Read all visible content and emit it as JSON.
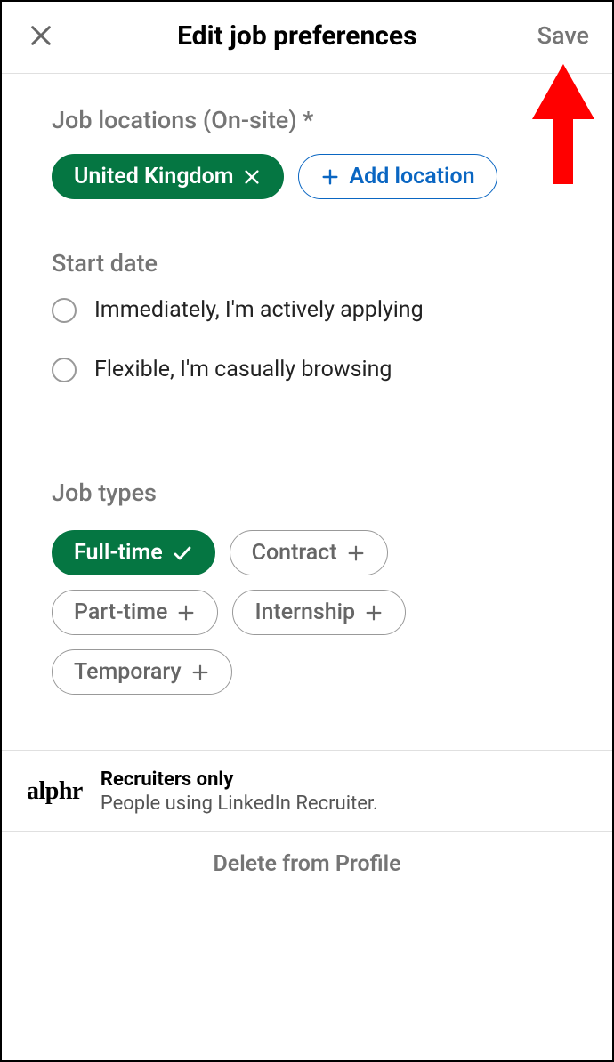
{
  "header": {
    "title": "Edit job preferences",
    "save_label": "Save"
  },
  "locations": {
    "title": "Job locations (On-site) *",
    "selected": "United Kingdom",
    "add_label": "Add location"
  },
  "start_date": {
    "title": "Start date",
    "options": [
      "Immediately, I'm actively applying",
      "Flexible, I'm casually browsing"
    ]
  },
  "job_types": {
    "title": "Job types",
    "items": [
      {
        "label": "Full-time",
        "selected": true
      },
      {
        "label": "Contract",
        "selected": false
      },
      {
        "label": "Part-time",
        "selected": false
      },
      {
        "label": "Internship",
        "selected": false
      },
      {
        "label": "Temporary",
        "selected": false
      }
    ]
  },
  "footer": {
    "logo": "alphr",
    "title": "Recruiters only",
    "desc": "People using LinkedIn Recruiter."
  },
  "delete_label": "Delete from Profile"
}
